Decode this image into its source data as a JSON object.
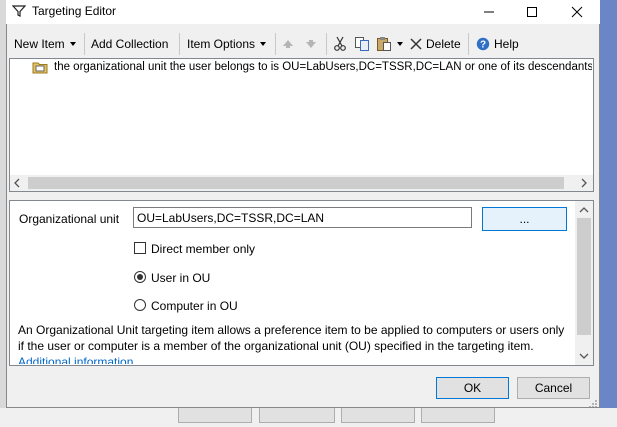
{
  "window": {
    "title": "Targeting Editor",
    "icon": "filter-icon",
    "controls": [
      "minimize-icon",
      "maximize-icon",
      "close-icon"
    ]
  },
  "toolbar": {
    "new_item": "New Item",
    "add_collection": "Add Collection",
    "item_options": "Item Options",
    "move_up_icon": "arrow-up-icon",
    "move_down_icon": "arrow-down-icon",
    "cut_icon": "scissors-icon",
    "copy_icon": "copy-icon",
    "paste_icon": "paste-icon",
    "delete": "Delete",
    "help": "Help"
  },
  "tree": {
    "items": [
      {
        "icon": "ou-folder-icon",
        "text": "the organizational unit the user belongs to is OU=LabUsers,DC=TSSR,DC=LAN or one of its descendants"
      }
    ]
  },
  "properties": {
    "ou_label": "Organizational unit",
    "ou_value": "OU=LabUsers,DC=TSSR,DC=LAN",
    "browse_label": "...",
    "direct_member_label": "Direct member only",
    "direct_member_checked": false,
    "user_in_ou_label": "User in OU",
    "computer_in_ou_label": "Computer in OU",
    "selected_option": "User in OU",
    "description": "An Organizational Unit targeting item allows a preference item to be applied to computers or users only if the user or computer is a member of the organizational unit (OU) specified in the targeting item.",
    "additional_info_link": "Additional information..."
  },
  "footer": {
    "ok": "OK",
    "cancel": "Cancel"
  },
  "colors": {
    "accent": "#0078d7",
    "link": "#0066cc",
    "background_window": "#6b86c6"
  }
}
